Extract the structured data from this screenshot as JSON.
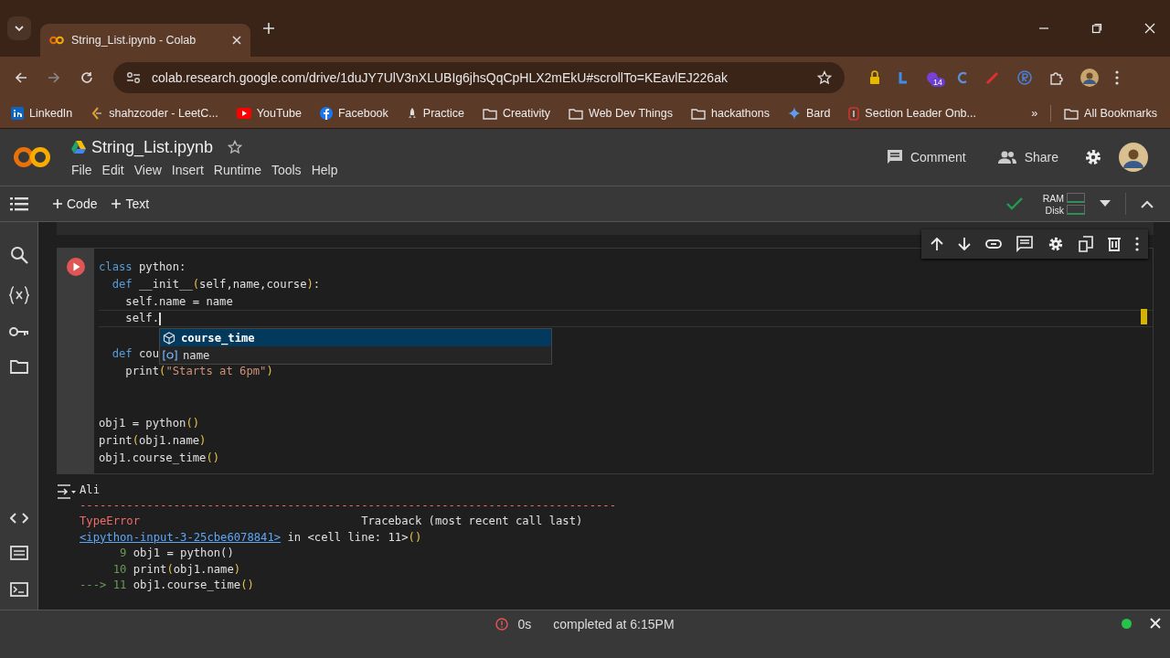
{
  "browser": {
    "tab": {
      "title": "String_List.ipynb - Colab",
      "selected": true
    },
    "url": "colab.research.google.com/drive/1duJY7UlV3nXLUBIg6jhsQqCpHLX2mEkU#scrollTo=KEavlEJ226ak",
    "extension_badge": "14",
    "bookmarks": [
      {
        "label": "LinkedIn",
        "kind": "linkedin"
      },
      {
        "label": "shahzcoder - LeetC...",
        "kind": "leetcode"
      },
      {
        "label": "YouTube",
        "kind": "youtube"
      },
      {
        "label": "Facebook",
        "kind": "facebook"
      },
      {
        "label": "Practice",
        "kind": "rocket"
      },
      {
        "label": "Creativity",
        "kind": "folder"
      },
      {
        "label": "Web Dev Things",
        "kind": "folder"
      },
      {
        "label": "hackathons",
        "kind": "folder"
      },
      {
        "label": "Bard",
        "kind": "sparkle"
      },
      {
        "label": "Section Leader Onb...",
        "kind": "badge"
      }
    ],
    "overflow": "»",
    "all_bookmarks": "All Bookmarks"
  },
  "notebook": {
    "title": "String_List.ipynb",
    "menu": [
      "File",
      "Edit",
      "View",
      "Insert",
      "Runtime",
      "Tools",
      "Help"
    ],
    "header_buttons": [
      {
        "label": "Comment",
        "kind": "comment"
      },
      {
        "label": "Share",
        "kind": "share"
      }
    ],
    "toolbar": [
      "Code",
      "Text"
    ],
    "resources": [
      "RAM",
      "Disk"
    ]
  },
  "cell": {
    "code_blocks": [
      [
        [
          {
            "t": "class",
            "kind": "keyword"
          },
          {
            "t": " python:",
            "kind": "name"
          }
        ],
        [
          {
            "t": "  def",
            "kind": "keyword"
          },
          {
            "t": " __init__",
            "kind": "name"
          },
          {
            "t": "(",
            "kind": "paren"
          },
          {
            "t": "self,name,course",
            "kind": "name"
          },
          {
            "t": ")",
            "kind": "paren"
          },
          {
            "t": ":",
            "kind": "name"
          }
        ],
        [
          {
            "t": "    self.name = name",
            "kind": "name"
          }
        ],
        [
          {
            "t": "    self.",
            "kind": "name"
          }
        ]
      ],
      [
        [
          {
            "t": "  def",
            "kind": "keyword"
          },
          {
            "t": " cou",
            "kind": "name"
          }
        ],
        [
          {
            "t": "    print",
            "kind": "name"
          },
          {
            "t": "(",
            "kind": "paren"
          },
          {
            "t": "\"Starts at 6pm\"",
            "kind": "string"
          },
          {
            "t": ")",
            "kind": "paren"
          }
        ]
      ],
      [
        [
          {
            "t": "obj1 = python",
            "kind": "name"
          },
          {
            "t": "()",
            "kind": "paren"
          }
        ],
        [
          {
            "t": "print",
            "kind": "name"
          },
          {
            "t": "(",
            "kind": "paren"
          },
          {
            "t": "obj1.name",
            "kind": "name"
          },
          {
            "t": ")",
            "kind": "paren"
          }
        ],
        [
          {
            "t": "obj1.course_time",
            "kind": "name"
          },
          {
            "t": "()",
            "kind": "paren"
          }
        ]
      ]
    ],
    "autocomplete": [
      {
        "label": "course_time",
        "kind": "method",
        "selected": true
      },
      {
        "label": "name",
        "kind": "field",
        "selected": false
      }
    ],
    "output": [
      [
        {
          "t": "Ali",
          "kind": "name"
        }
      ],
      [
        {
          "t": "--------------------------------------------------------------------------------",
          "kind": "error"
        }
      ],
      [
        {
          "t": "TypeError",
          "kind": "error"
        },
        {
          "t": "                                 Traceback (most recent call last)",
          "kind": "name"
        }
      ],
      [
        {
          "t": "<ipython-input-3-25cbe6078841>",
          "kind": "link"
        },
        {
          "t": " in <cell line: 11>",
          "kind": "name"
        },
        {
          "t": "()",
          "kind": "paren"
        }
      ],
      [
        {
          "t": "      9",
          "kind": "number"
        },
        {
          "t": " obj1 = python()",
          "kind": "name"
        }
      ],
      [
        {
          "t": "     10",
          "kind": "number"
        },
        {
          "t": " print",
          "kind": "name"
        },
        {
          "t": "(",
          "kind": "paren"
        },
        {
          "t": "obj1.name",
          "kind": "name"
        },
        {
          "t": ")",
          "kind": "paren"
        }
      ],
      [
        {
          "t": "---> 11",
          "kind": "number"
        },
        {
          "t": " obj1.course_time",
          "kind": "name"
        },
        {
          "t": "()",
          "kind": "paren"
        }
      ]
    ]
  },
  "status": {
    "duration": "0s",
    "completed": "completed at 6:15PM"
  }
}
